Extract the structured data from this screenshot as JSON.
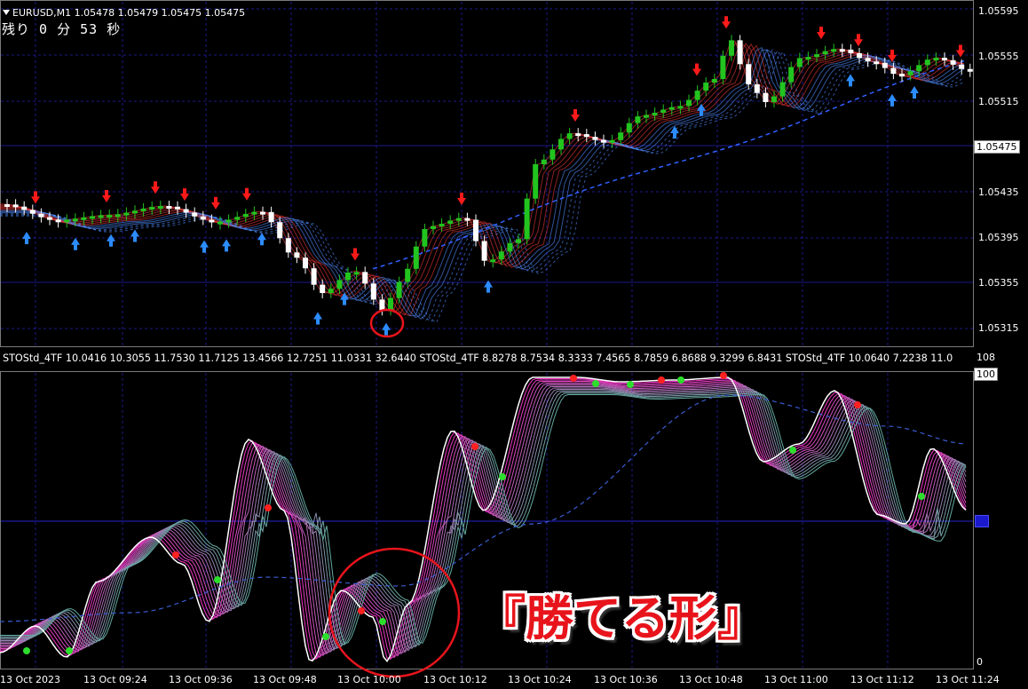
{
  "header": {
    "symbol_line": "EURUSD,M1  1.05478 1.05479 1.05475 1.05475",
    "countdown": "残り 0 分 53 秒"
  },
  "price_axis": {
    "ticks": [
      "1.05595",
      "1.05555",
      "1.05515",
      "1.05475",
      "1.05435",
      "1.05395",
      "1.05355",
      "1.05315"
    ],
    "current_price": "1.05475"
  },
  "indicator": {
    "label": "STOStd_4TF 10.0416 10.3055 11.7530 11.7125 13.4566 12.7251 11.0331 32.6440  STOStd_4TF 8.8278 8.7534 8.3333 7.4565 8.7859 6.8688 9.3299 6.8431  STOStd_4TF 10.0640 7.2238 11.0",
    "axis_top": "108",
    "axis_100": "100",
    "axis_0": "0"
  },
  "time_axis": [
    "13 Oct 2023",
    "13 Oct 09:24",
    "13 Oct 09:36",
    "13 Oct 09:48",
    "13 Oct 10:00",
    "13 Oct 10:12",
    "13 Oct 10:24",
    "13 Oct 10:36",
    "13 Oct 10:48",
    "13 Oct 11:00",
    "13 Oct 11:12",
    "13 Oct 11:24"
  ],
  "banner": "『勝てる形』",
  "colors": {
    "bull": "#22c41f",
    "bear": "#ffffff",
    "up_arrow": "#2c8cff",
    "down_arrow": "#ff1a1a",
    "grid": "#1a1a8a",
    "highlight": "#e8141c"
  }
}
